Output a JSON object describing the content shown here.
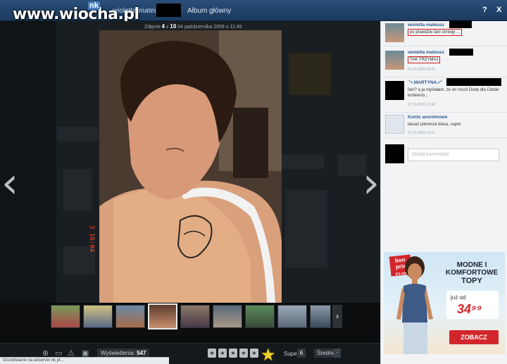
{
  "watermark": {
    "text": "www.wiocha.pl",
    "nk": "nk"
  },
  "header": {
    "user_name": "wioletta mateusz",
    "album_link": "Album główny",
    "help_label": "?",
    "close_label": "X"
  },
  "viewer": {
    "photo_prefix": "Zdjęcie",
    "photo_index": "4",
    "photo_of": "z",
    "photo_total": "10",
    "photo_date": "04 października 2009 o 11:45",
    "timestamp_overlay": "3 16:04",
    "prev_arrow": "‹",
    "next_arrow": "›",
    "thumb_next": "›"
  },
  "bottom": {
    "views_label": "Wyświetlenia:",
    "views_value": "547",
    "super_label": "Super",
    "super_count": "6",
    "avg_label": "Średnia:",
    "avg_value": "-"
  },
  "status_bar": "Oczekiwanie na adserver.nk.pl...",
  "comments": [
    {
      "name": "wioletta mateusz",
      "text": "po prawdzie fani stmieję ...",
      "date": ""
    },
    {
      "name": "wioletta mateusz",
      "text": "TAK TRZYMAJ",
      "date": "05.10.2009 09:22"
    },
    {
      "name": "`°•.MARTYNA.•°`",
      "text": "fani? a ja myślałam, że on rzucił Dodę dla Ciebie królewno...",
      "date": "17.10.2009 15:40"
    },
    {
      "name": "Konto anonimowe",
      "text": "tatuaż pierwsza klasa, super",
      "date": "17.10.2009 13:11"
    }
  ],
  "comment_input": {
    "placeholder": "Dodaj komentarz"
  },
  "ad": {
    "logo_line1": "bon",
    "logo_line2": "prix",
    "logo_line3": "it's me!",
    "headline": "MODNE I KOMFORTOWE",
    "headline2": "TOPY",
    "from": "już od",
    "price": "34⁹⁹",
    "button": "ZOBACZ"
  },
  "colors": {
    "accent_red": "#d2262c",
    "header_blue": "#1b3a5e",
    "link_blue": "#2b5a8a"
  },
  "icons": [
    "zoom-icon",
    "print-icon",
    "warning-icon",
    "gift-icon",
    "star-icon",
    "super-star-icon"
  ]
}
